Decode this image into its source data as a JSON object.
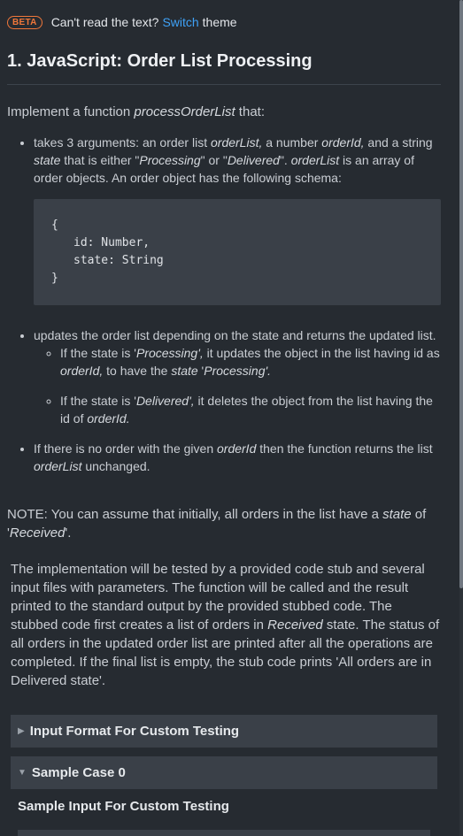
{
  "topbar": {
    "beta": "BETA",
    "prefix": "Can't read the text?",
    "switch_link": "Switch",
    "suffix": "theme"
  },
  "title": "1. JavaScript: Order List Processing",
  "intro": {
    "a": "Implement a function ",
    "fn": "processOrderList",
    "b": " that:"
  },
  "bullet1": {
    "t1": "takes 3 arguments: an order list ",
    "v1": "orderList,",
    "t2": " a number ",
    "v2": "orderId,",
    "t3": " and a string ",
    "v3": "state",
    "t4": " that is either \"",
    "v4": "Processing",
    "t5": "\" or \"",
    "v5": "Delivered",
    "t6": "\". ",
    "v6": "orderList",
    "t7": " is an array of order objects. An order object has the following schema:"
  },
  "code": {
    "l1": "{",
    "l2": "id: Number,",
    "l3": "state: String",
    "l4": "}"
  },
  "bullet2": {
    "text": "updates the order list depending on the state and returns the updated list.",
    "sub1": {
      "t1": "If the state is '",
      "v1": "Processing',",
      "t2": " it updates the object in the list having id as ",
      "v2": "orderId,",
      "t3": " to have the ",
      "v3": "state",
      "t4": " '",
      "v4": "Processing'."
    },
    "sub2": {
      "t1": "If the state is '",
      "v1": "Delivered',",
      "t2": " it deletes the object from the list having the id of ",
      "v2": "orderId."
    }
  },
  "bullet3": {
    "t1": "If there is no order with the given ",
    "v1": "orderId",
    "t2": " then the function returns the list ",
    "v2": "orderList",
    "t3": " unchanged."
  },
  "note": {
    "t1": "NOTE: You can assume that initially, all orders in the list have a ",
    "v1": "state",
    "t2": " of '",
    "v2": "Received",
    "t3": "'."
  },
  "para": {
    "t1": "The implementation will be tested by a provided code stub and several input files with parameters. The function will be called and the result printed to the standard output by the provided stubbed code. The stubbed code first creates a list of orders in ",
    "v1": "Received",
    "t2": " state. The status of all orders in the updated order list are printed after all the operations are completed. If the final list is empty, the stub code prints 'All orders are in Delivered state'."
  },
  "sections": {
    "input_format": "Input Format For Custom Testing",
    "sample_case": "Sample Case 0",
    "sample_input": "Sample Input For Custom Testing"
  },
  "icons": {
    "collapsed": "triangle-right-icon",
    "expanded": "triangle-down-icon"
  },
  "colors": {
    "background": "#262b31",
    "accent_link": "#3fa2f7",
    "beta_badge": "#f0773a",
    "panel": "#3a4048"
  }
}
